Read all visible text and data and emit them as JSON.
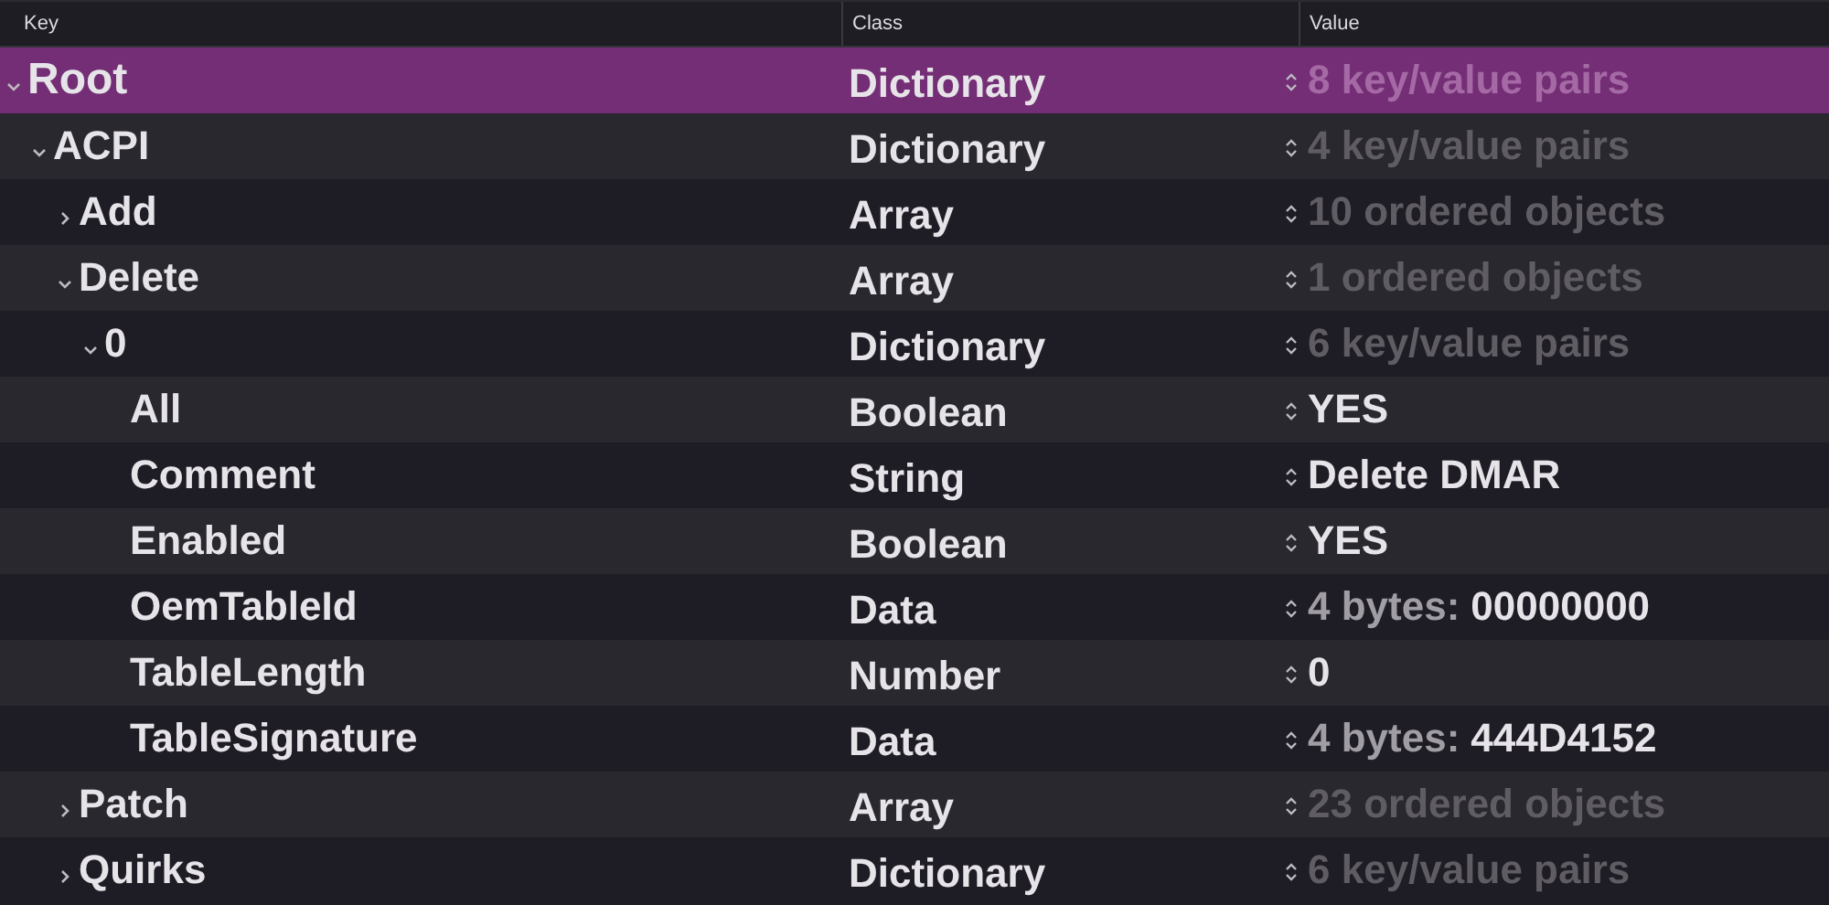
{
  "columns": [
    "Key",
    "Class",
    "Value"
  ],
  "rows": [
    {
      "key": "Root",
      "class": "Dictionary",
      "value": {
        "kind": "summary",
        "text": "8 key/value pairs"
      },
      "selected": true,
      "expanded": true,
      "children": [
        {
          "key": "ACPI",
          "class": "Dictionary",
          "value": {
            "kind": "summary",
            "text": "4 key/value pairs"
          },
          "selected": false,
          "expanded": true,
          "children": [
            {
              "key": "Add",
              "class": "Array",
              "value": {
                "kind": "summary",
                "text": "10 ordered objects"
              },
              "selected": false,
              "expanded": false
            },
            {
              "key": "Delete",
              "class": "Array",
              "value": {
                "kind": "summary",
                "text": "1 ordered objects"
              },
              "selected": false,
              "expanded": true,
              "children": [
                {
                  "key": "0",
                  "class": "Dictionary",
                  "value": {
                    "kind": "summary",
                    "text": "6 key/value pairs"
                  },
                  "selected": false,
                  "expanded": true,
                  "children": [
                    {
                      "key": "All",
                      "class": "Boolean",
                      "value": {
                        "kind": "scalar",
                        "text": "YES"
                      },
                      "selected": false
                    },
                    {
                      "key": "Comment",
                      "class": "String",
                      "value": {
                        "kind": "scalar",
                        "text": "Delete DMAR"
                      },
                      "selected": false
                    },
                    {
                      "key": "Enabled",
                      "class": "Boolean",
                      "value": {
                        "kind": "scalar",
                        "text": "YES"
                      },
                      "selected": false
                    },
                    {
                      "key": "OemTableId",
                      "class": "Data",
                      "value": {
                        "kind": "data",
                        "prefix": "4 bytes:",
                        "bytes": "00000000"
                      },
                      "selected": false
                    },
                    {
                      "key": "TableLength",
                      "class": "Number",
                      "value": {
                        "kind": "scalar",
                        "text": "0"
                      },
                      "selected": false
                    },
                    {
                      "key": "TableSignature",
                      "class": "Data",
                      "value": {
                        "kind": "data",
                        "prefix": "4 bytes:",
                        "bytes": "444D4152"
                      },
                      "selected": false
                    }
                  ]
                }
              ]
            },
            {
              "key": "Patch",
              "class": "Array",
              "value": {
                "kind": "summary",
                "text": "23 ordered objects"
              },
              "selected": false,
              "expanded": false
            },
            {
              "key": "Quirks",
              "class": "Dictionary",
              "value": {
                "kind": "summary",
                "text": "6 key/value pairs"
              },
              "selected": false,
              "expanded": false
            }
          ]
        }
      ]
    }
  ]
}
